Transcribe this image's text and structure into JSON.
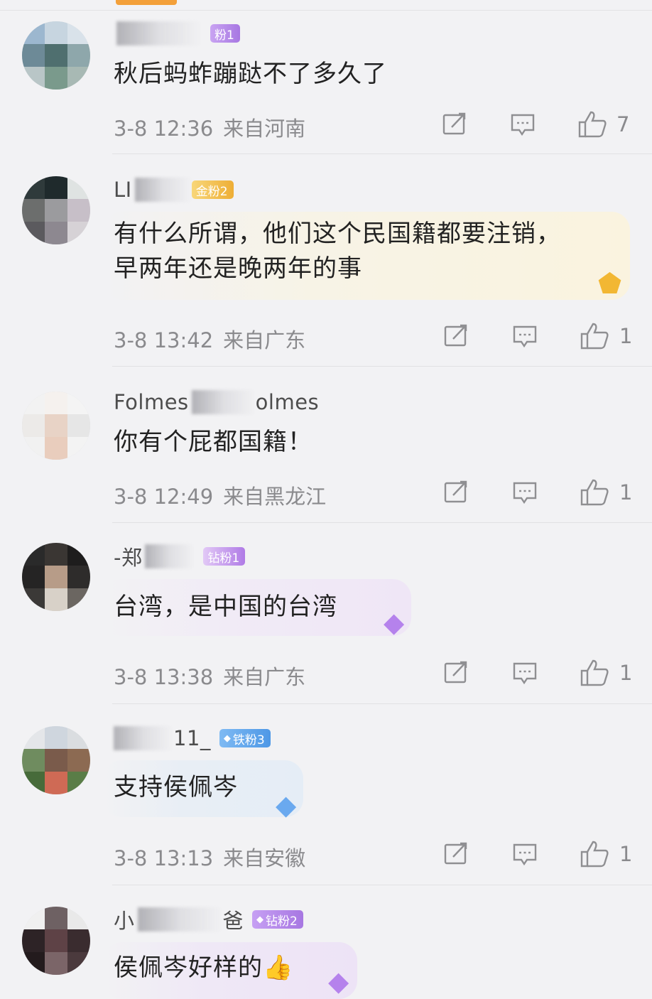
{
  "comments": [
    {
      "username": "",
      "badge": "粉1",
      "text": "秋后蚂蚱蹦跶不了多久了",
      "time": "3-8 12:36",
      "location": "来自河南",
      "likes": "7"
    },
    {
      "username": "LI",
      "badge": "金粉2",
      "text_line1": "有什么所谓，他们这个民国籍都要注销，",
      "text_line2": "早两年还是晚两年的事",
      "time": "3-8 13:42",
      "location": "来自广东",
      "likes": "1"
    },
    {
      "username": "Folmes",
      "username_suffix": "olmes",
      "text": "你有个屁都国籍！",
      "time": "3-8 12:49",
      "location": "来自黑龙江",
      "likes": "1"
    },
    {
      "username": "-郑",
      "badge": "钻粉1",
      "text": "台湾，是中国的台湾",
      "time": "3-8 13:38",
      "location": "来自广东",
      "likes": "1"
    },
    {
      "username": "11_",
      "badge": "铁粉3",
      "text": "支持侯佩岑",
      "time": "3-8 13:13",
      "location": "来自安徽",
      "likes": "1"
    },
    {
      "username": "小",
      "username_suffix": "爸",
      "badge": "钻粉2",
      "text": "侯佩岑好样的👍",
      "time": "",
      "location": "",
      "likes": ""
    }
  ],
  "colors": {
    "badge_purple": "#b07be6",
    "badge_gold": "#f2bc45",
    "badge_blue": "#5aa3ec",
    "meta_gray": "#8a8a8d",
    "divider": "#e1e1e3"
  },
  "icons": [
    "share-icon",
    "comment-icon",
    "like-icon"
  ]
}
